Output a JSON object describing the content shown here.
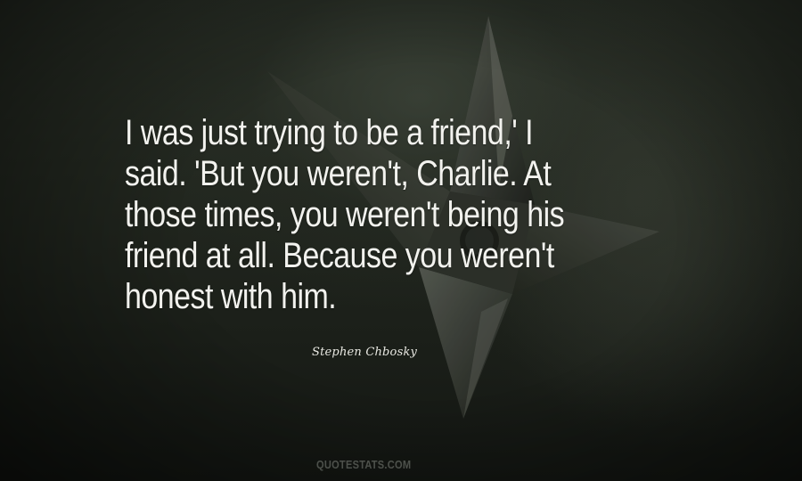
{
  "quote": {
    "lines": [
      "I was just trying to be a friend,' I",
      "said. 'But you weren't, Charlie. At",
      "those times, you weren't being his",
      "friend at all. Because you weren't",
      "honest with him."
    ]
  },
  "author": "Stephen Chbosky",
  "watermark": "QUOTESTATS.COM",
  "background": {
    "subject": "shuriken-throwing-star",
    "base_color": "#1b1f19",
    "text_color": "#f2f2ee"
  }
}
